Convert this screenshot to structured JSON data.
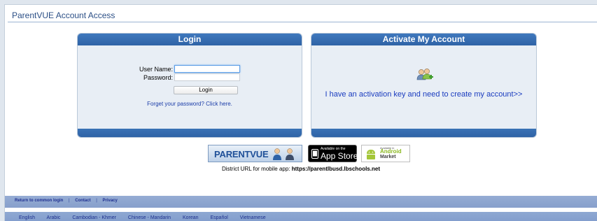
{
  "header": {
    "title": "ParentVUE Account Access"
  },
  "login": {
    "heading": "Login",
    "username_label": "User Name:",
    "username_value": "",
    "password_label": "Password:",
    "password_value": "",
    "button_label": "Login",
    "forgot_link": "Forget your password? Click here."
  },
  "activate": {
    "heading": "Activate My Account",
    "icon": "users-add-icon",
    "link": "I have an activation key and need to create my account>>"
  },
  "badges": {
    "parentvue_text": "PARENTVUE",
    "appstore_small": "Available on the",
    "appstore_big": "App Store",
    "android_small": "Available in",
    "android_big": "Android",
    "android_sub": "Market"
  },
  "district": {
    "label": "District URL for mobile app:",
    "url": "https://parentlbusd.lbschools.net"
  },
  "footer": {
    "links": [
      "Return to common login",
      "Contact",
      "Privacy"
    ],
    "separator": "|"
  },
  "languages": [
    "English",
    "Arabic",
    "Cambodian - Khmer",
    "Chinese - Mandarin",
    "Korean",
    "Español",
    "Vietnamese"
  ],
  "colors": {
    "panel_header": "#2f63a6",
    "link_blue": "#1a3cbf",
    "footer_bar": "#8ea8d2"
  }
}
